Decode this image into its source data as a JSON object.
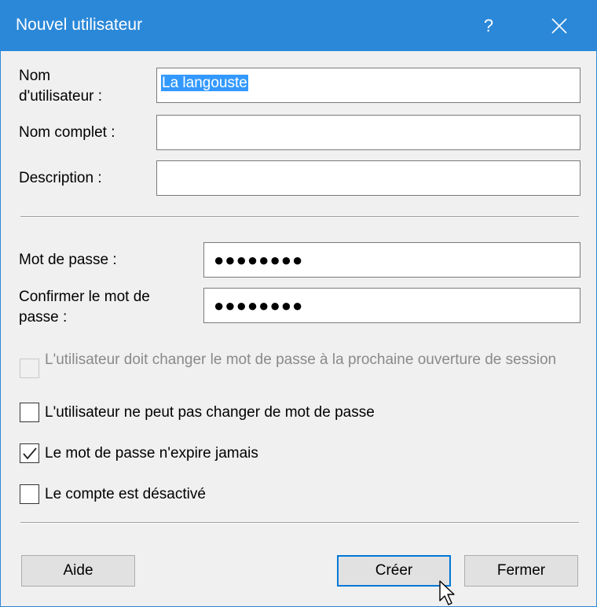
{
  "window": {
    "title": "Nouvel utilisateur",
    "help_glyph": "?",
    "accent_color": "#2b88d8"
  },
  "fields": {
    "username": {
      "label_line1": "Nom",
      "label_line2": "d'utilisateur :",
      "value": "La langouste"
    },
    "fullname": {
      "label": "Nom complet :",
      "value": ""
    },
    "description": {
      "label": "Description :",
      "value": ""
    },
    "password": {
      "label": "Mot de passe :",
      "value": "●●●●●●●●"
    },
    "confirm": {
      "label_line1": "Confirmer le mot de",
      "label_line2": "passe :",
      "value": "●●●●●●●●"
    }
  },
  "options": [
    {
      "label": "L'utilisateur doit changer le mot de passe à la prochaine ouverture de session",
      "checked": false,
      "disabled": true
    },
    {
      "label": "L'utilisateur ne peut pas changer de mot de passe",
      "checked": false,
      "disabled": false
    },
    {
      "label": "Le mot de passe n'expire jamais",
      "checked": true,
      "disabled": false
    },
    {
      "label": "Le compte est désactivé",
      "checked": false,
      "disabled": false
    }
  ],
  "buttons": {
    "help": "Aide",
    "create": "Créer",
    "close": "Fermer"
  }
}
